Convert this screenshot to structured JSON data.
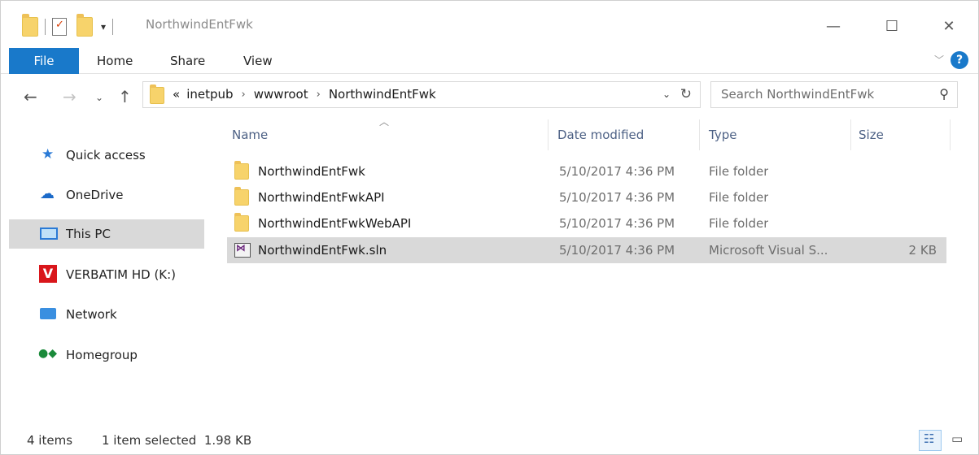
{
  "window": {
    "title": "NorthwindEntFwk",
    "minimize": "—",
    "maximize": "☐",
    "close": "✕"
  },
  "ribbon": {
    "tabs": [
      {
        "label": "File"
      },
      {
        "label": "Home"
      },
      {
        "label": "Share"
      },
      {
        "label": "View"
      }
    ],
    "help": "?"
  },
  "address": {
    "prefix": "«",
    "crumbs": [
      "inetpub",
      "wwwroot",
      "NorthwindEntFwk"
    ],
    "separator": "›"
  },
  "search": {
    "placeholder": "Search NorthwindEntFwk"
  },
  "nav": {
    "items": [
      {
        "label": "Quick access",
        "icon": "star-icon"
      },
      {
        "label": "OneDrive",
        "icon": "cloud-icon"
      },
      {
        "label": "This PC",
        "icon": "computer-icon"
      },
      {
        "label": "VERBATIM HD (K:)",
        "icon": "drive-icon"
      },
      {
        "label": "Network",
        "icon": "network-icon"
      },
      {
        "label": "Homegroup",
        "icon": "homegroup-icon"
      }
    ],
    "selected": "This PC"
  },
  "columns": {
    "name": "Name",
    "date": "Date modified",
    "type": "Type",
    "size": "Size"
  },
  "files": [
    {
      "name": "NorthwindEntFwk",
      "date": "5/10/2017 4:36 PM",
      "type": "File folder",
      "size": "",
      "icon": "folder-icon"
    },
    {
      "name": "NorthwindEntFwkAPI",
      "date": "5/10/2017 4:36 PM",
      "type": "File folder",
      "size": "",
      "icon": "folder-icon"
    },
    {
      "name": "NorthwindEntFwkWebAPI",
      "date": "5/10/2017 4:36 PM",
      "type": "File folder",
      "size": "",
      "icon": "folder-icon"
    },
    {
      "name": "NorthwindEntFwk.sln",
      "date": "5/10/2017 4:36 PM",
      "type": "Microsoft Visual S...",
      "size": "2 KB",
      "icon": "visual-studio-solution-icon"
    }
  ],
  "status": {
    "count": "4 items",
    "selection": "1 item selected  1.98 KB"
  },
  "colors": {
    "accent": "#1979ca",
    "selection": "#d9d9d9",
    "folder": "#f7d36b"
  }
}
